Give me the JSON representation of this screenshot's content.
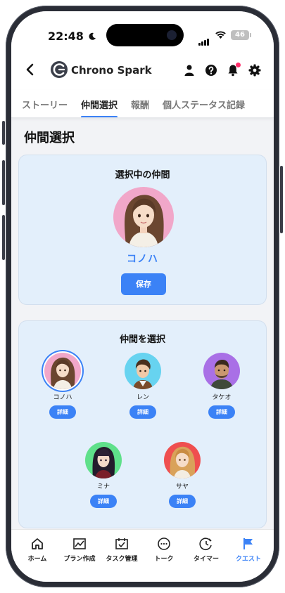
{
  "status": {
    "time": "22:48",
    "battery": "46"
  },
  "header": {
    "brand": "Chrono Spark"
  },
  "tabs": [
    {
      "label": "ストーリー"
    },
    {
      "label": "仲間選択"
    },
    {
      "label": "報酬"
    },
    {
      "label": "個人ステータス記録"
    }
  ],
  "page": {
    "title": "仲間選択"
  },
  "selected": {
    "title": "選択中の仲間",
    "name": "コノハ",
    "save_label": "保存"
  },
  "picker": {
    "title": "仲間を選択",
    "detail_label": "詳細",
    "companions": [
      {
        "name": "コノハ",
        "color": "#f1a7c9"
      },
      {
        "name": "レン",
        "color": "#67d3f0"
      },
      {
        "name": "タケオ",
        "color": "#a970e6"
      },
      {
        "name": "ミナ",
        "color": "#5fe08a"
      },
      {
        "name": "サヤ",
        "color": "#ef4f4f"
      }
    ]
  },
  "nav": [
    {
      "label": "ホーム",
      "icon": "home-icon"
    },
    {
      "label": "プラン作成",
      "icon": "chart-icon"
    },
    {
      "label": "タスク管理",
      "icon": "calendar-check-icon"
    },
    {
      "label": "トーク",
      "icon": "chat-icon"
    },
    {
      "label": "タイマー",
      "icon": "timer-icon"
    },
    {
      "label": "クエスト",
      "icon": "flag-icon"
    }
  ],
  "colors": {
    "accent": "#3b82f6",
    "card_bg": "#e3effb",
    "notification": "#ff2d6a"
  }
}
